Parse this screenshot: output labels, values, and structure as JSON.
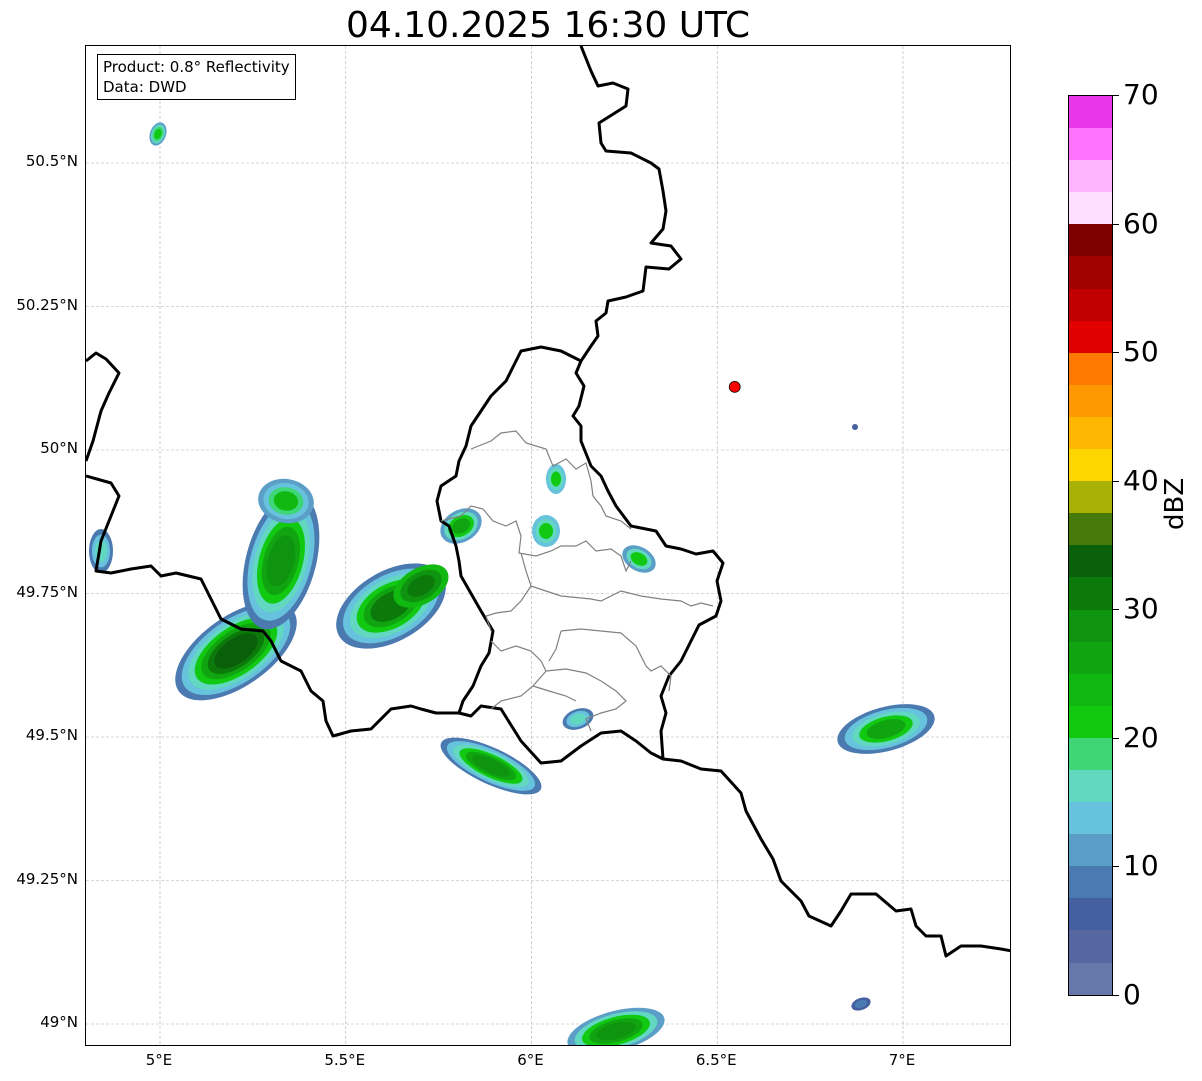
{
  "title": "04.10.2025 16:30 UTC",
  "info": {
    "product": "Product: 0.8° Reflectivity",
    "source": "Data: DWD"
  },
  "map": {
    "lon_range": [
      4.8,
      7.3
    ],
    "lat_range": [
      48.95,
      50.7
    ],
    "grid": true,
    "lat_ticks": [
      "50.5°N",
      "50.25°N",
      "50°N",
      "49.75°N",
      "49.5°N",
      "49.25°N",
      "49°N"
    ],
    "lon_ticks": [
      "5°E",
      "5.5°E",
      "6°E",
      "6.5°E",
      "7°E"
    ],
    "radar_site": {
      "lon": 6.547,
      "lat": 50.11,
      "color": "#ff0000"
    }
  },
  "colorbar": {
    "label": "dBZ",
    "ticks": [
      "0",
      "10",
      "20",
      "30",
      "40",
      "50",
      "60",
      "70"
    ],
    "colors": [
      "#6677aa",
      "#5566a0",
      "#4460a0",
      "#4a7ab0",
      "#5b9fc8",
      "#67c2dd",
      "#62d8c0",
      "#3fd677",
      "#11c911",
      "#10b810",
      "#10a510",
      "#0e940e",
      "#0b7a0b",
      "#0a600a",
      "#467a0b",
      "#aab106",
      "#ffd500",
      "#ffb600",
      "#ff9700",
      "#ff7900",
      "#e00000",
      "#c00000",
      "#a10000",
      "#800000",
      "#ffdfff",
      "#ffb4ff",
      "#ff73ff",
      "#ea36ea"
    ]
  }
}
